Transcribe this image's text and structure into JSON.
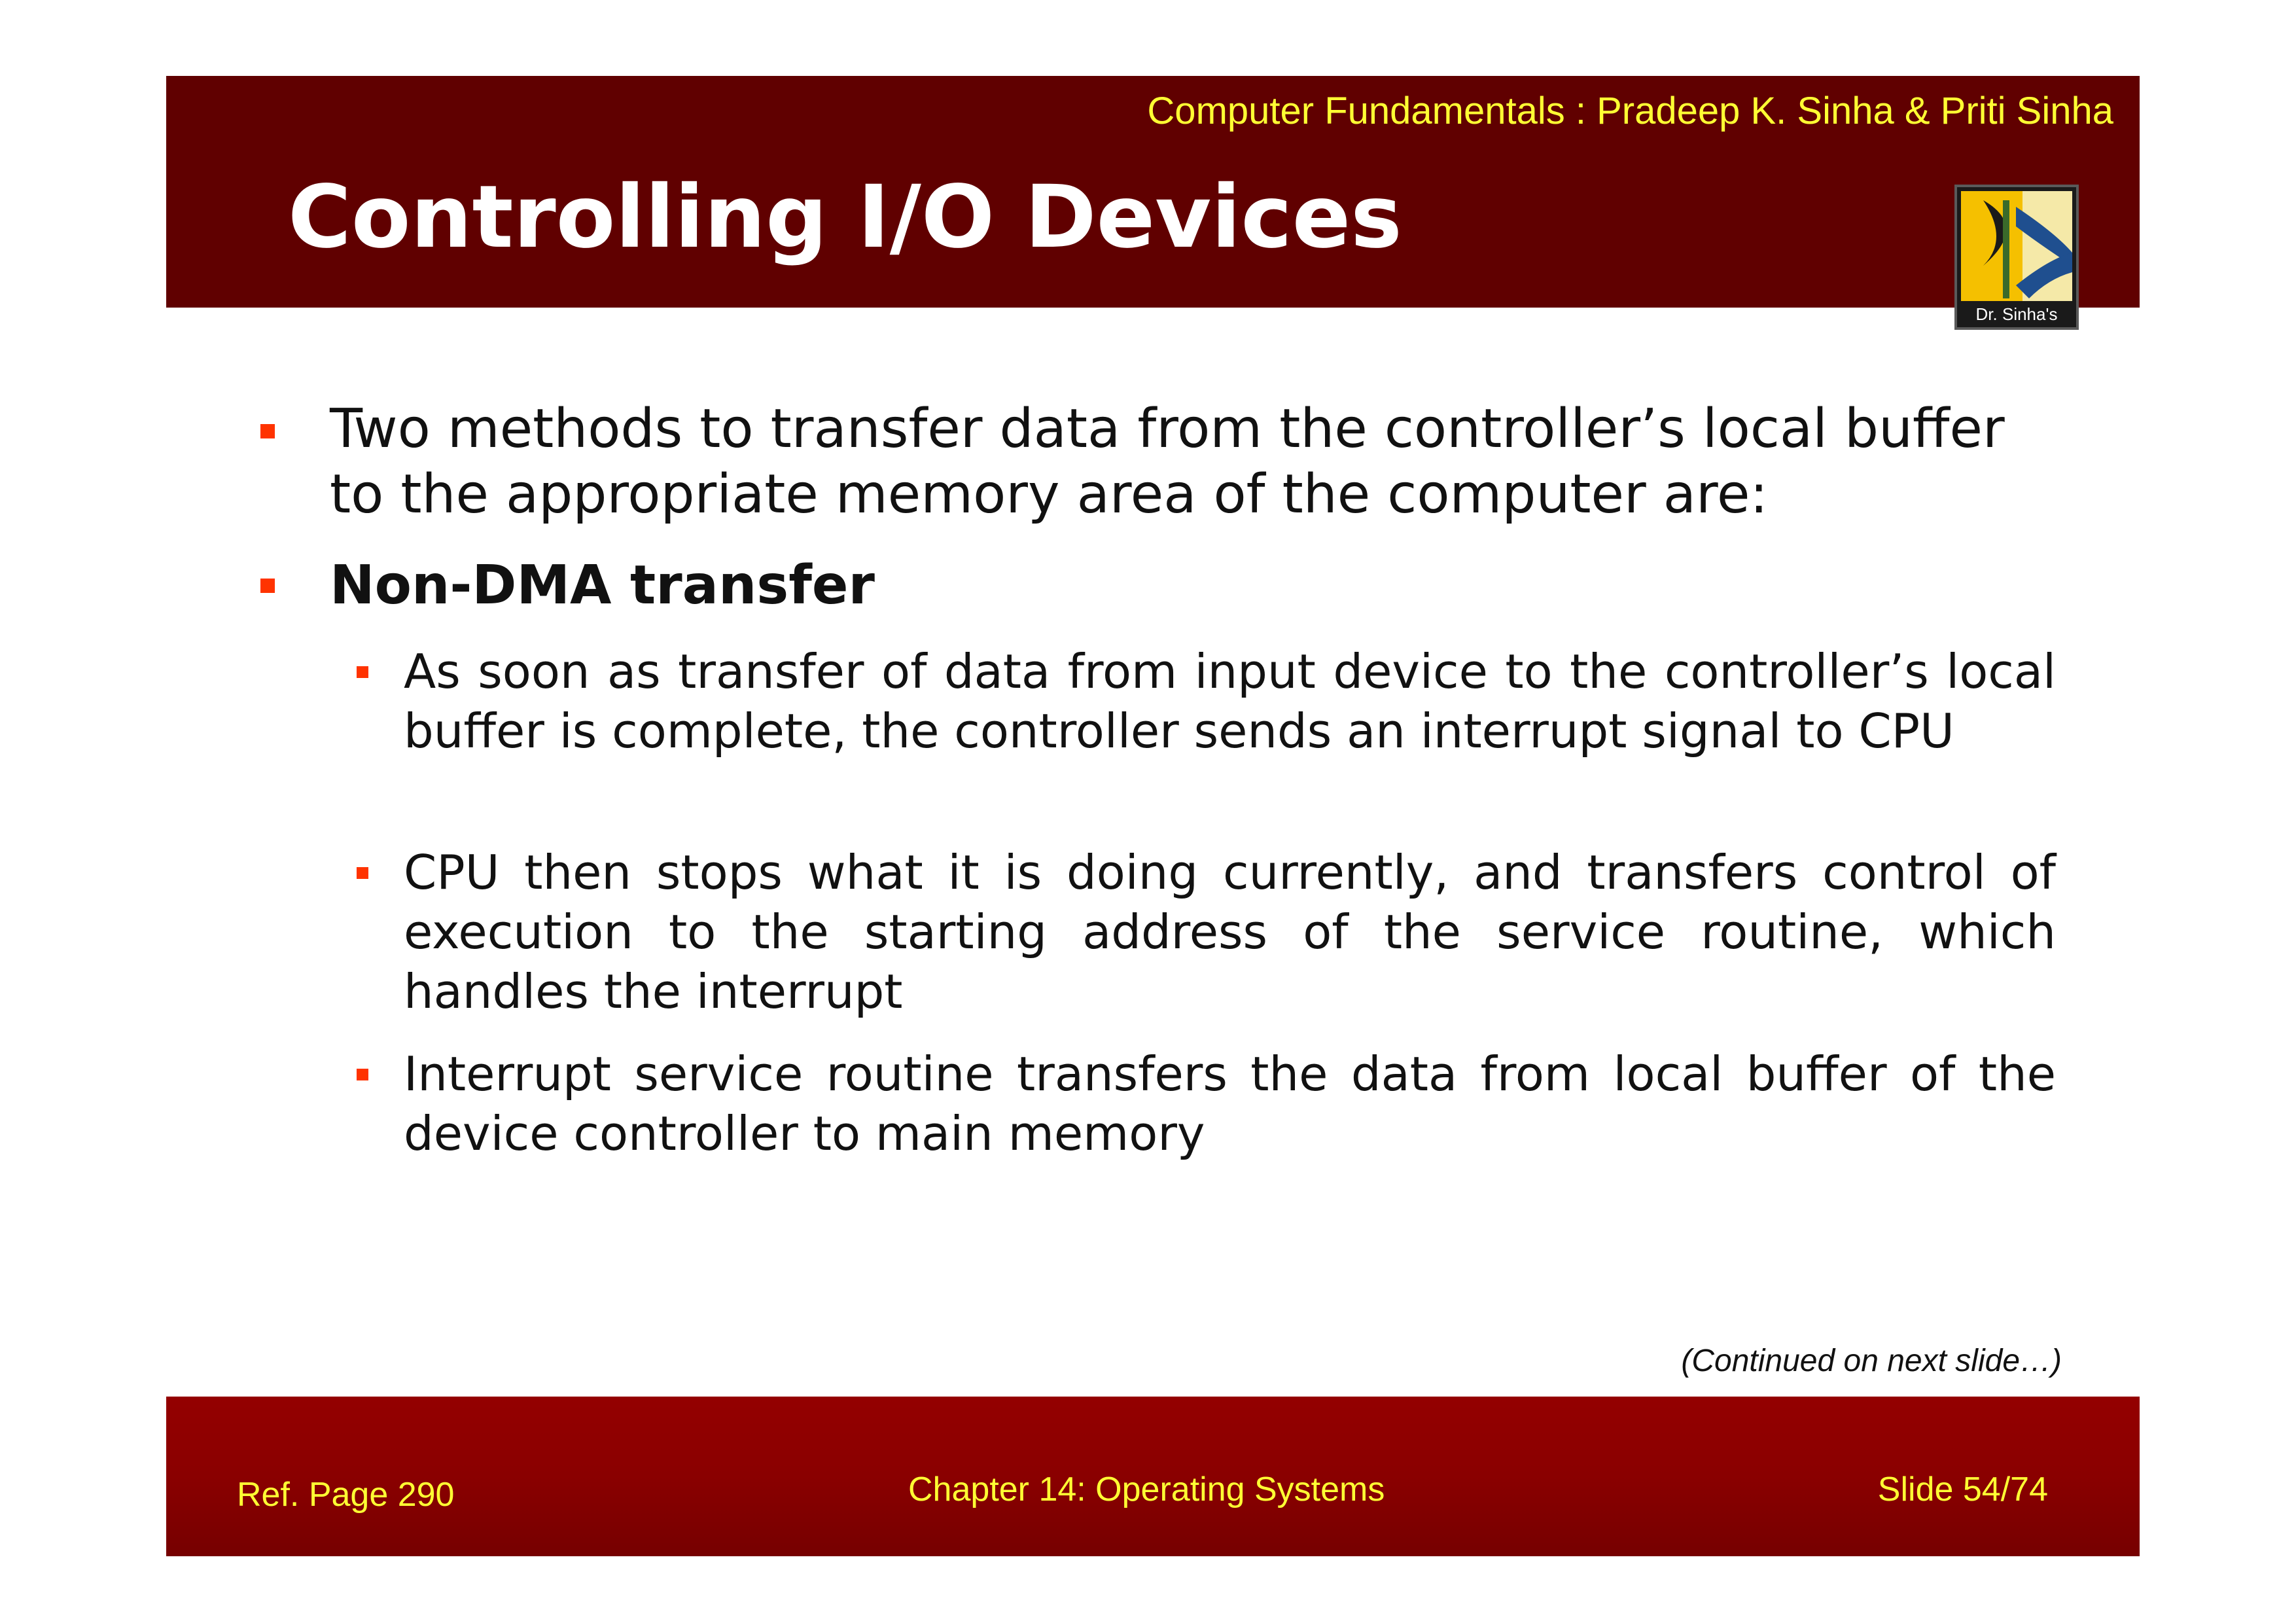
{
  "header": {
    "subtitle": "Computer Fundamentals : Pradeep K. Sinha & Priti Sinha",
    "title": "Controlling I/O Devices",
    "logo_caption": "Dr. Sinha's"
  },
  "body": {
    "items": [
      {
        "text": "Two methods to transfer data from the controller’s local buffer to the appropriate memory area of the computer are:",
        "bold": false
      },
      {
        "text": "Non-DMA transfer",
        "bold": true,
        "subitems": [
          {
            "text": "As soon as transfer of data from input device to the controller’s local buffer is complete, the controller sends an interrupt signal to CPU"
          },
          {
            "text": "CPU then stops what it is doing currently, and transfers control of execution to the starting address of the service routine, which handles the interrupt"
          },
          {
            "text": "Interrupt service routine transfers the data from local buffer of the device controller to main memory"
          }
        ]
      }
    ],
    "continued_note": "(Continued on next slide…)"
  },
  "footer": {
    "ref_page": "Ref. Page  290",
    "chapter": "Chapter 14: Operating Systems",
    "slide": "Slide 54/74"
  },
  "colors": {
    "header_bg": "#600000",
    "footer_bg": "#8a0000",
    "accent_text": "#ffff33",
    "bullet": "#ff3300"
  },
  "icons": {
    "bullet": "square-bullet",
    "logo": "dr-sinha-logo"
  }
}
